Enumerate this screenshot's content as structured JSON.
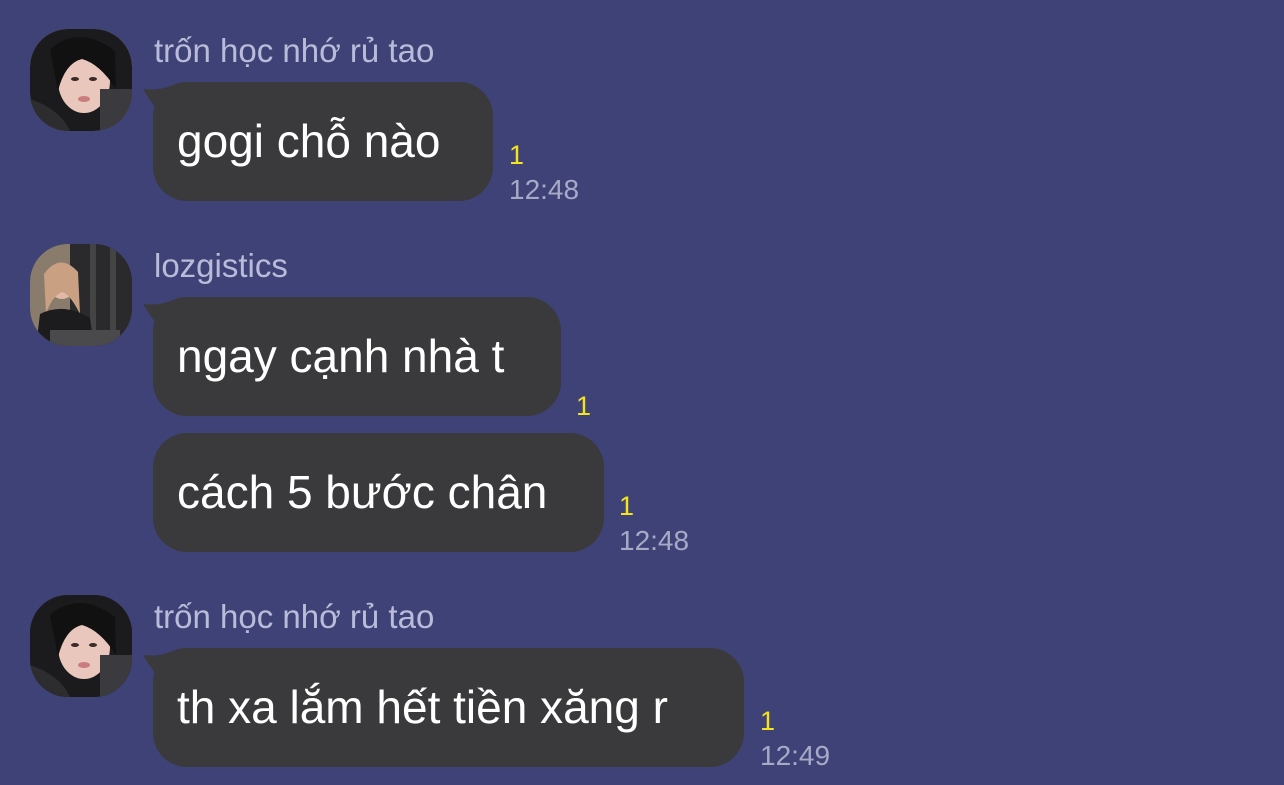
{
  "messages": [
    {
      "sender": "trốn học nhớ rủ tao",
      "text": "gogi chỗ nào",
      "unread": "1",
      "time": "12:48"
    },
    {
      "sender": "lozgistics",
      "text": "ngay cạnh nhà t",
      "unread": "1"
    },
    {
      "text": "cách 5 bước chân",
      "unread": "1",
      "time": "12:48"
    },
    {
      "sender": "trốn học nhớ rủ tao",
      "text": "th xa lắm hết tiền xăng r",
      "unread": "1",
      "time": "12:49"
    }
  ],
  "colors": {
    "background": "#3f4277",
    "bubble": "#3a3a3c",
    "unread": "#f5e31c",
    "time": "#a7aac6",
    "sender": "#b9bcd9"
  }
}
